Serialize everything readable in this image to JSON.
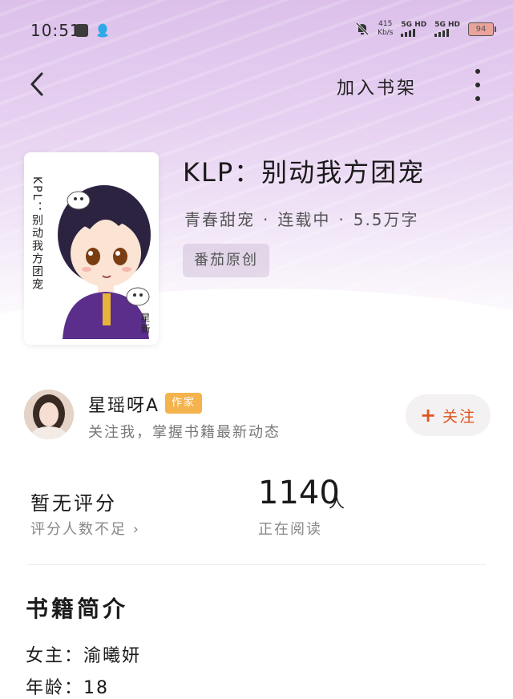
{
  "status_bar": {
    "time": "10:51",
    "net_speed_value": "415",
    "net_speed_unit": "Kb/s",
    "sim1_label": "5G HD",
    "sim2_label": "5G HD",
    "battery": "94",
    "icons": [
      "gallery-icon",
      "qq-icon",
      "mute-bell-icon",
      "signal-icon",
      "battery-icon"
    ]
  },
  "nav": {
    "back_icon": "chevron-left-icon",
    "add_to_shelf": "加入书架",
    "more_icon": "more-vertical-icon"
  },
  "book": {
    "title": "KLP：别动我方团宠",
    "genre": "青春甜宠",
    "status": "连载中",
    "word_count": "5.5万字",
    "separator": "·",
    "tag": "番茄原创",
    "cover": {
      "vertical_title": "KPL：别动我方团宠",
      "signature": "星新"
    }
  },
  "author": {
    "name": "星瑶呀A",
    "badge": "作家",
    "description": "关注我，掌握书籍最新动态",
    "follow_label": "关注",
    "follow_icon": "plus-icon"
  },
  "stats": {
    "rating_main": "暂无评分",
    "rating_sub": "评分人数不足",
    "rating_sub_icon": "chevron-right-icon",
    "readers_count": "1140",
    "readers_unit": "人",
    "readers_label": "正在阅读"
  },
  "intro": {
    "title": "书籍简介",
    "lines": [
      "女主：渝曦妍",
      "年龄：18"
    ]
  },
  "colors": {
    "accent": "#e0551f",
    "badge": "#f5b34d",
    "hero_purple": "#dcc0ea"
  }
}
